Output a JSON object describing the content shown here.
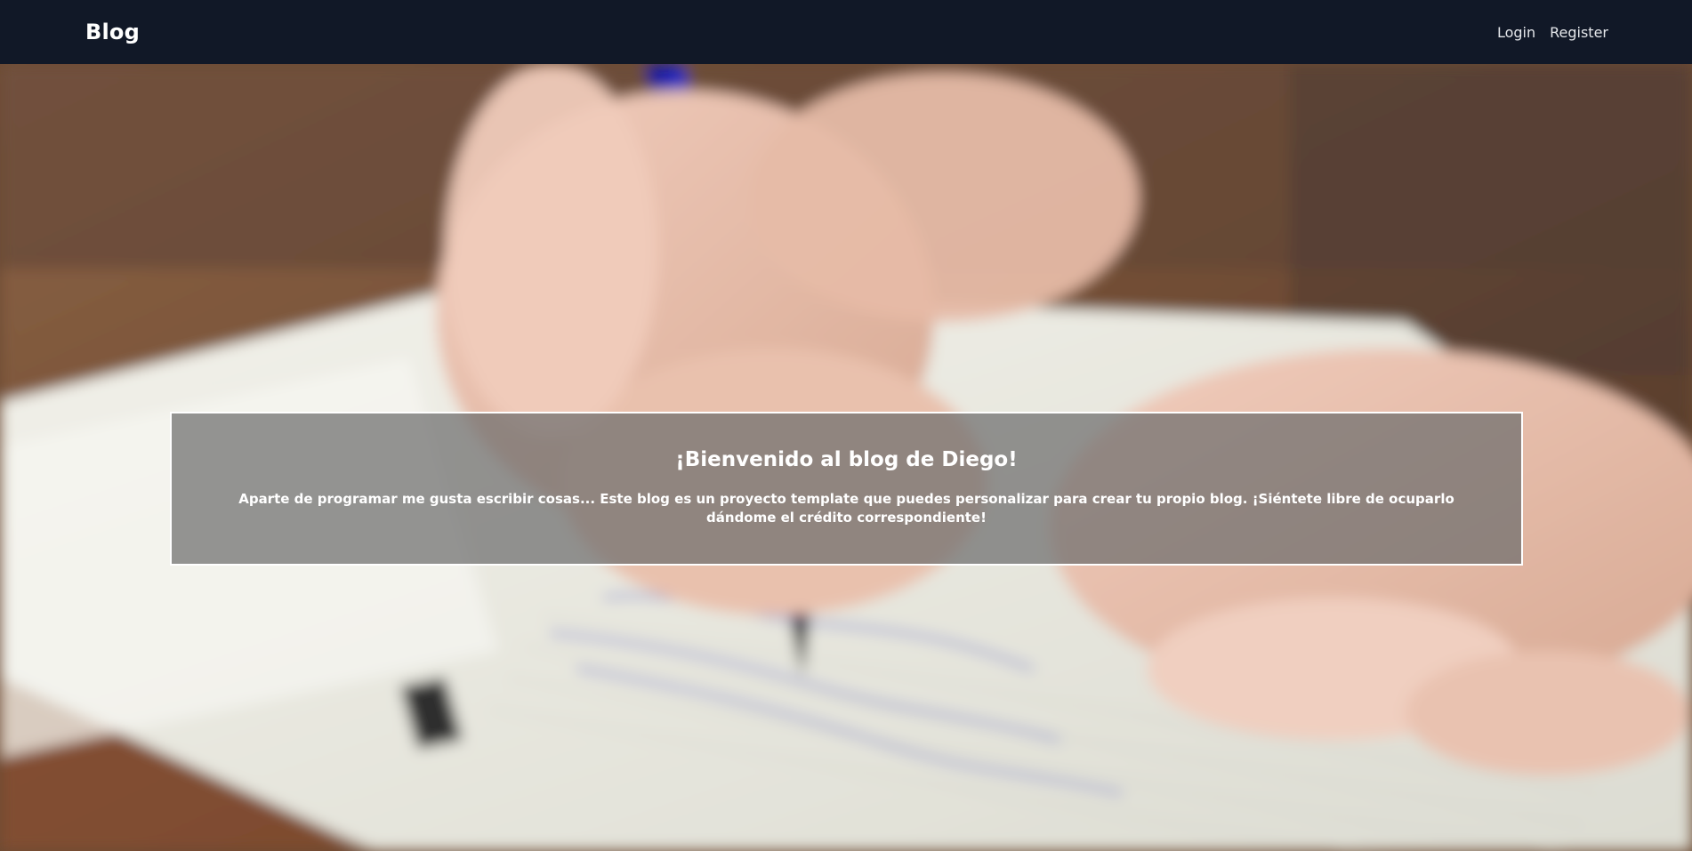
{
  "navbar": {
    "brand": "Blog",
    "links": [
      {
        "label": "Login"
      },
      {
        "label": "Register"
      }
    ]
  },
  "hero": {
    "background_icon": "writing-photo",
    "title": "¡Bienvenido al blog de Diego!",
    "text": "Aparte de programar me gusta escribir cosas... Este blog es un proyecto template que puedes personalizar para crear tu propio blog. ¡Siéntete libre de ocuparlo dándome el crédito correspondiente!"
  },
  "colors": {
    "navbar_bg": "#111827",
    "card_bg": "rgba(110,110,110,0.72)",
    "card_border": "#ffffff",
    "text": "#ffffff"
  }
}
